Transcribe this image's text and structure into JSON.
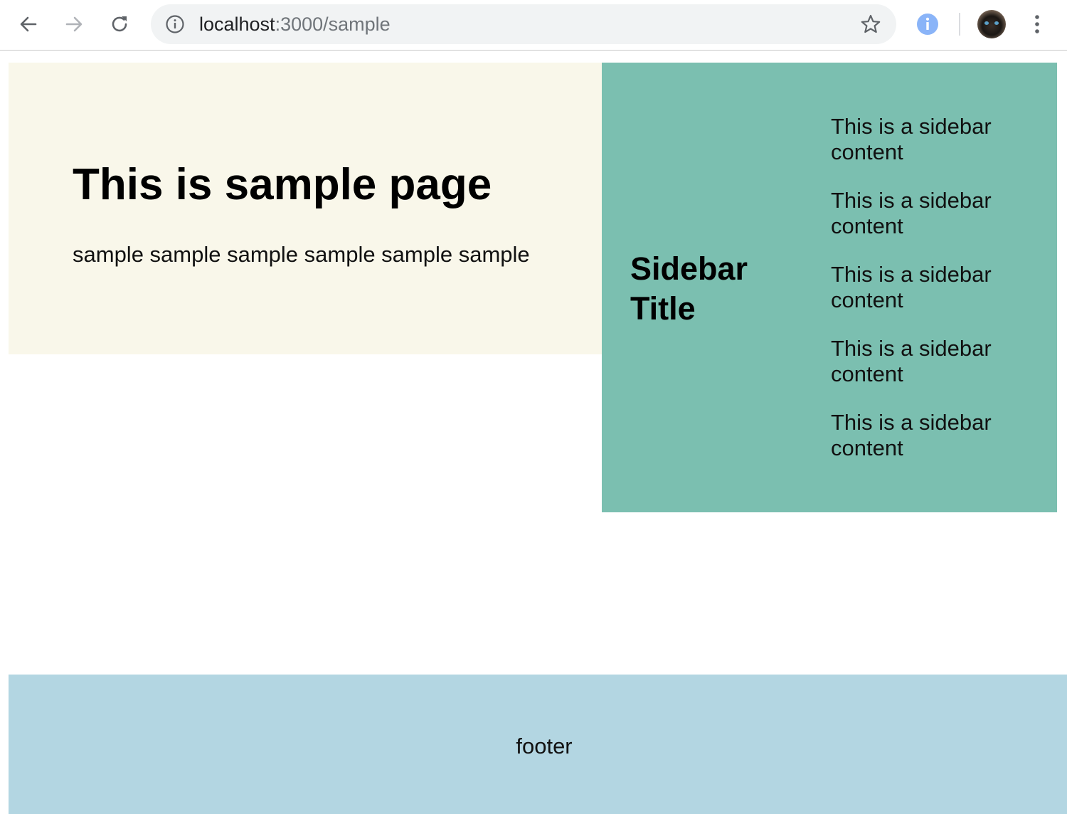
{
  "browser": {
    "url_host": "localhost",
    "url_path": ":3000/sample",
    "icons": {
      "back": "arrow-left-icon",
      "forward": "arrow-right-icon",
      "reload": "reload-icon",
      "site_info": "info-circle-icon",
      "bookmark": "star-icon",
      "extension": "info-extension-icon",
      "menu": "kebab-menu-icon"
    },
    "colors": {
      "omnibox_bg": "#f1f3f4",
      "extension_blue": "#8ab4f8"
    }
  },
  "main": {
    "title": "This is sample page",
    "text": "sample sample sample sample sample sample",
    "background": "#f9f7ea"
  },
  "sidebar": {
    "title": "Sidebar Title",
    "items": [
      "This is a sidebar content",
      "This is a sidebar content",
      "This is a sidebar content",
      "This is a sidebar content",
      "This is a sidebar content"
    ],
    "background": "#7bbfb0"
  },
  "footer": {
    "text": "footer",
    "background": "#b3d6e2"
  }
}
